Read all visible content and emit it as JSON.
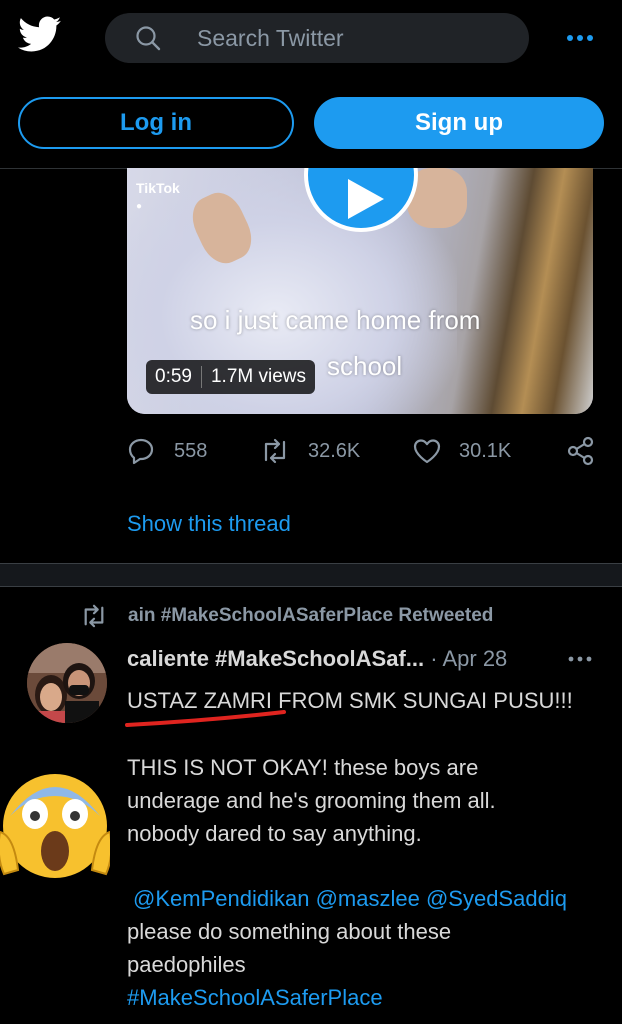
{
  "header": {
    "search_placeholder": "Search Twitter",
    "login_label": "Log in",
    "signup_label": "Sign up",
    "accent": "#1d9bf0"
  },
  "video": {
    "source_label": "TikTok",
    "caption_line1": "so i just came home from",
    "caption_line2": "school",
    "duration": "0:59",
    "views": "1.7M views"
  },
  "actions": {
    "replies": "558",
    "retweets": "32.6K",
    "likes": "30.1K"
  },
  "show_thread": "Show this thread",
  "tweet": {
    "retweeted_by": "ain #MakeSchoolASaferPlace Retweeted",
    "author": "caliente #MakeSchoolASaf...",
    "separator": "·",
    "date": "Apr 28",
    "line1": "USTAZ ZAMRI FROM SMK SUNGAI PUSU!!!",
    "line2": "THIS IS NOT OKAY! these boys are",
    "line3": "underage and he's grooming them all.",
    "line4": "nobody dared to say anything.",
    "mentions": [
      "@KemPendidikan",
      "@maszlee",
      "@SyedSaddiq"
    ],
    "line5": "please do something about these",
    "line6": "paedophiles",
    "hashtag": "#MakeSchoolASaferPlace"
  }
}
